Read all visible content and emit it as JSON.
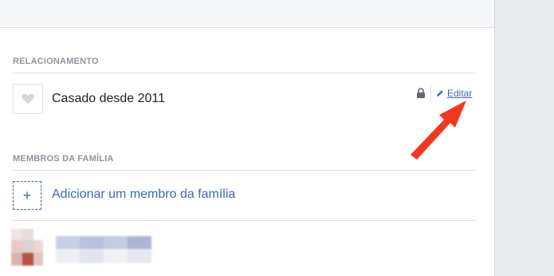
{
  "relationship": {
    "section_title": "RELACIONAMENTO",
    "status": "Casado desde 2011",
    "edit_label": "Editar",
    "icon": "heart-icon",
    "privacy_icon": "lock-icon"
  },
  "family": {
    "section_title": "MEMBROS DA FAMÍLIA",
    "add_label": "Adicionar um membro da família",
    "add_icon": "plus-icon"
  },
  "colors": {
    "link": "#4267b2",
    "section_header": "#90949c",
    "text": "#1d2129",
    "annotation_arrow": "#f3371d"
  }
}
